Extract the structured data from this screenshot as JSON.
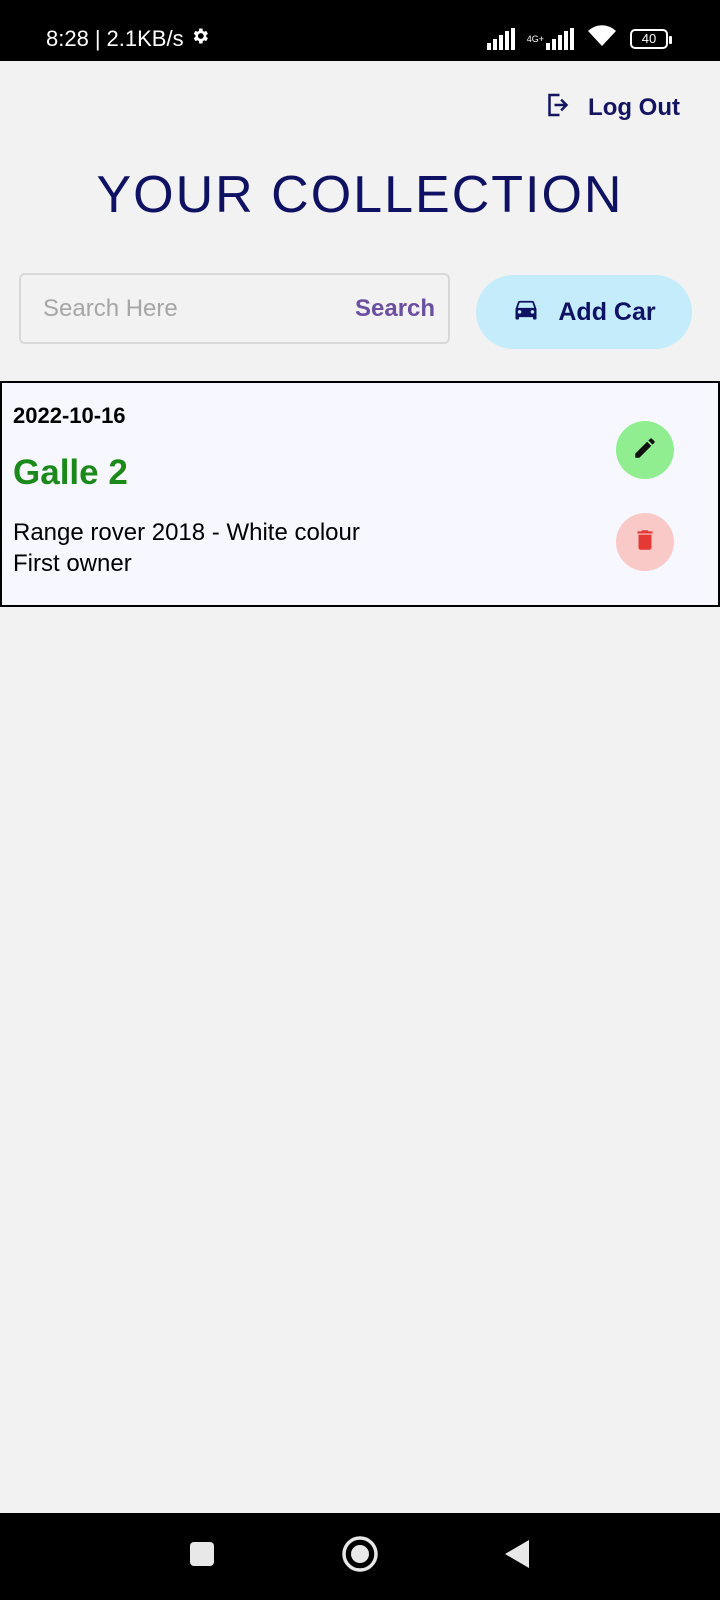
{
  "status_bar": {
    "time": "8:28",
    "separator": "|",
    "speed": "2.1KB/s",
    "network": "4G+",
    "battery": "40"
  },
  "header": {
    "logout_label": "Log Out",
    "title": "YOUR COLLECTION"
  },
  "search": {
    "placeholder": "Search Here",
    "value": "",
    "button_label": "Search"
  },
  "add_car": {
    "label": "Add Car"
  },
  "cars": [
    {
      "date": "2022-10-16",
      "name": "Galle 2",
      "description_line1": "Range rover 2018 - White colour",
      "description_line2": "First owner"
    }
  ],
  "colors": {
    "title": "#0f1162",
    "car_name": "#1b8a1b",
    "edit_button": "#90ee90",
    "delete_button": "#f8c9c6",
    "delete_icon": "#e53935",
    "add_car_button": "#c4ecfb",
    "search_button": "#6b4fa0"
  }
}
